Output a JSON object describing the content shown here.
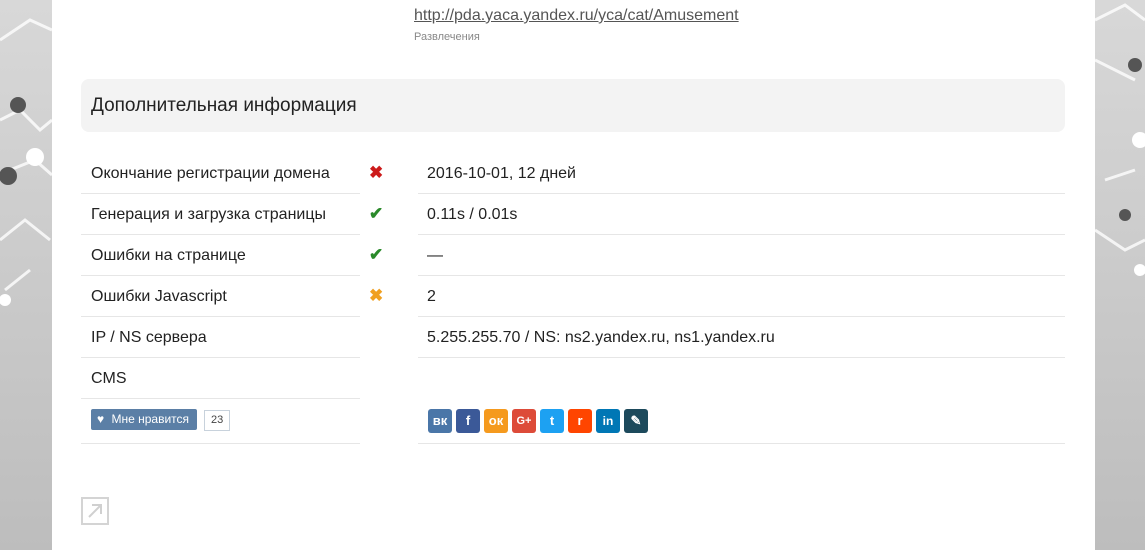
{
  "top": {
    "link": "http://pda.yaca.yandex.ru/yca/cat/Amusement",
    "caption": "Развлечения"
  },
  "section": {
    "title": "Дополнительная информация"
  },
  "rows": [
    {
      "label": "Окончание регистрации домена",
      "status": "✖",
      "value": "2016-10-01, 12 дней"
    },
    {
      "label": "Генерация и загрузка страницы",
      "status": "✔",
      "value": "0.11s / 0.01s"
    },
    {
      "label": "Ошибки на странице",
      "status": "✔",
      "value": "—"
    },
    {
      "label": "Ошибки Javascript",
      "status": "✖",
      "value": "2"
    },
    {
      "label": "IP / NS сервера",
      "status": "",
      "value": "5.255.255.70 / NS: ns2.yandex.ru, ns1.yandex.ru"
    },
    {
      "label": "CMS",
      "status": "",
      "value": ""
    }
  ],
  "like": {
    "label": "Мне нравится",
    "count": "23"
  },
  "share": {
    "icons": [
      "vk-icon",
      "facebook-icon",
      "odnoklassniki-icon",
      "google-plus-icon",
      "twitter-icon",
      "reddit-icon",
      "linkedin-icon",
      "livejournal-icon"
    ],
    "colors": [
      "#4a76a8",
      "#3b5998",
      "#f59a1e",
      "#dd4b39",
      "#1da1f2",
      "#ff4500",
      "#0077b5",
      "#1d4a5c"
    ]
  }
}
